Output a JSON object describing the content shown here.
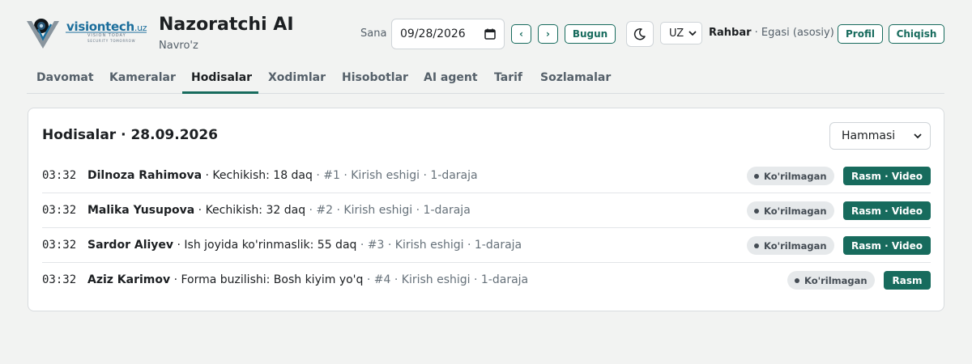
{
  "brand": {
    "name": "visiontech",
    "domain": ".uz",
    "tagline1": "VISION TODAY",
    "tagline2": "SECURITY TOMORROW"
  },
  "app": {
    "title": "Nazoratchi AI",
    "subtitle": "Navro'z"
  },
  "date": {
    "label": "Sana",
    "value": "09/28/2026"
  },
  "controls": {
    "prev": "‹",
    "next": "›",
    "today": "Bugun",
    "lang": "UZ",
    "user_role": "Rahbar",
    "user_sub": " · Egasi (asosiy)",
    "profile": "Profil",
    "logout": "Chiqish"
  },
  "tabs": [
    {
      "label": "Davomat"
    },
    {
      "label": "Kameralar"
    },
    {
      "label": "Hodisalar"
    },
    {
      "label": "Xodimlar"
    },
    {
      "label": "Hisobotlar"
    },
    {
      "label": "AI agent"
    },
    {
      "label": "Tarif"
    },
    {
      "label": "Sozlamalar"
    }
  ],
  "card": {
    "title": "Hodisalar · 28.09.2026",
    "filter": "Hammasi",
    "rows": [
      {
        "time": "03:32",
        "name": "Dilnoza Rahimova",
        "event": " · Kechikish: 18 daq",
        "meta": " · #1 · Kirish eshigi · 1-daraja",
        "status": "Ko'rilmagan",
        "action": "Rasm · Video"
      },
      {
        "time": "03:32",
        "name": "Malika Yusupova",
        "event": " · Kechikish: 32 daq",
        "meta": " · #2 · Kirish eshigi · 1-daraja",
        "status": "Ko'rilmagan",
        "action": "Rasm · Video"
      },
      {
        "time": "03:32",
        "name": "Sardor Aliyev",
        "event": " · Ish joyida ko'rinmaslik: 55 daq",
        "meta": " · #3 · Kirish eshigi · 1-daraja",
        "status": "Ko'rilmagan",
        "action": "Rasm · Video"
      },
      {
        "time": "03:32",
        "name": "Aziz Karimov",
        "event": " · Forma buzilishi: Bosh kiyim yo'q",
        "meta": " · #4 · Kirish eshigi · 1-daraja",
        "status": "Ko'rilmagan",
        "action": "Rasm"
      }
    ]
  },
  "colors": {
    "accent": "#176b5d",
    "brand": "#1c6e9c"
  }
}
